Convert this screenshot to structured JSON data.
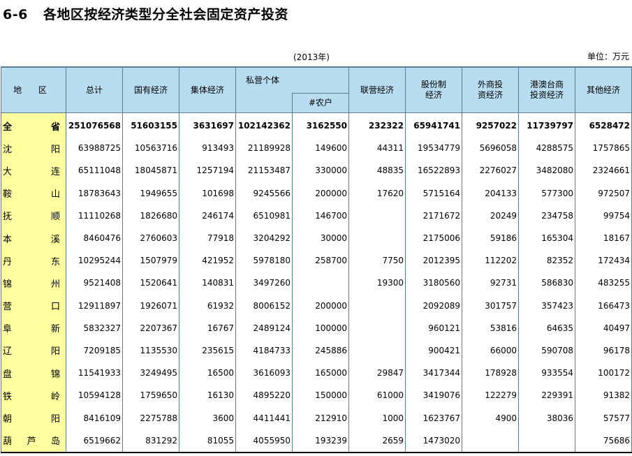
{
  "title": {
    "number": "6-6",
    "text": "各地区按经济类型分全社会固定资产投资"
  },
  "year": "(2013年)",
  "unit": "单位：万元",
  "headers": {
    "region": "地 区",
    "total": "总计",
    "state": "国有经济",
    "collective": "集体经济",
    "private": "私营个体",
    "farmer": "#农户",
    "joint": "联营经济",
    "shareholding_1": "股份制",
    "shareholding_2": "经济",
    "foreign_1": "外商投",
    "foreign_2": "资经济",
    "hkmt_1": "港澳台商",
    "hkmt_2": "投资经济",
    "other": "其他经济"
  },
  "rows": [
    {
      "region": "全省",
      "values": [
        "251076568",
        "51603155",
        "3631697",
        "102142362",
        "3162550",
        "232322",
        "65941741",
        "9257022",
        "11739797",
        "6528472"
      ]
    },
    {
      "region": "沈阳",
      "values": [
        "63988725",
        "10563716",
        "913493",
        "21189928",
        "149600",
        "44311",
        "19534779",
        "5696058",
        "4288575",
        "1757865"
      ]
    },
    {
      "region": "大连",
      "values": [
        "65111048",
        "18045871",
        "1257194",
        "21153487",
        "330000",
        "48835",
        "16522893",
        "2276027",
        "3482080",
        "2324661"
      ]
    },
    {
      "region": "鞍山",
      "values": [
        "18783643",
        "1949655",
        "101698",
        "9245566",
        "200000",
        "17620",
        "5715164",
        "204133",
        "577300",
        "972507"
      ]
    },
    {
      "region": "抚顺",
      "values": [
        "11110268",
        "1826680",
        "246174",
        "6510981",
        "146700",
        "",
        "2171672",
        "20249",
        "234758",
        "99754"
      ]
    },
    {
      "region": "本溪",
      "values": [
        "8460476",
        "2760603",
        "77918",
        "3204292",
        "30000",
        "",
        "2175006",
        "59186",
        "165304",
        "18167"
      ]
    },
    {
      "region": "丹东",
      "values": [
        "10295244",
        "1507979",
        "421952",
        "5978180",
        "258700",
        "7750",
        "2012395",
        "112202",
        "82352",
        "172434"
      ]
    },
    {
      "region": "锦州",
      "values": [
        "9521408",
        "1520641",
        "140831",
        "3497260",
        "",
        "19300",
        "3180560",
        "92731",
        "586830",
        "483255"
      ]
    },
    {
      "region": "营口",
      "values": [
        "12911897",
        "1926071",
        "61932",
        "8006152",
        "200000",
        "",
        "2092089",
        "301757",
        "357423",
        "166473"
      ]
    },
    {
      "region": "阜新",
      "values": [
        "5832327",
        "2207367",
        "16767",
        "2489124",
        "100000",
        "",
        "960121",
        "53816",
        "64635",
        "40497"
      ]
    },
    {
      "region": "辽阳",
      "values": [
        "7209185",
        "1135530",
        "235615",
        "4184733",
        "245886",
        "",
        "900421",
        "66000",
        "590708",
        "96178"
      ]
    },
    {
      "region": "盘锦",
      "values": [
        "11541933",
        "3249495",
        "16500",
        "3616093",
        "165000",
        "29847",
        "3417344",
        "178928",
        "933554",
        "100172"
      ]
    },
    {
      "region": "铁岭",
      "values": [
        "10594128",
        "1759650",
        "16130",
        "4895220",
        "150000",
        "61000",
        "3419076",
        "122279",
        "229391",
        "91382"
      ]
    },
    {
      "region": "朝阳",
      "values": [
        "8416109",
        "2275788",
        "3600",
        "4411441",
        "212910",
        "1000",
        "1623767",
        "4900",
        "38036",
        "57577"
      ]
    },
    {
      "region": "葫芦岛",
      "values": [
        "6519662",
        "831292",
        "81055",
        "4055950",
        "193239",
        "2659",
        "1473020",
        "",
        "",
        "75686"
      ]
    }
  ]
}
